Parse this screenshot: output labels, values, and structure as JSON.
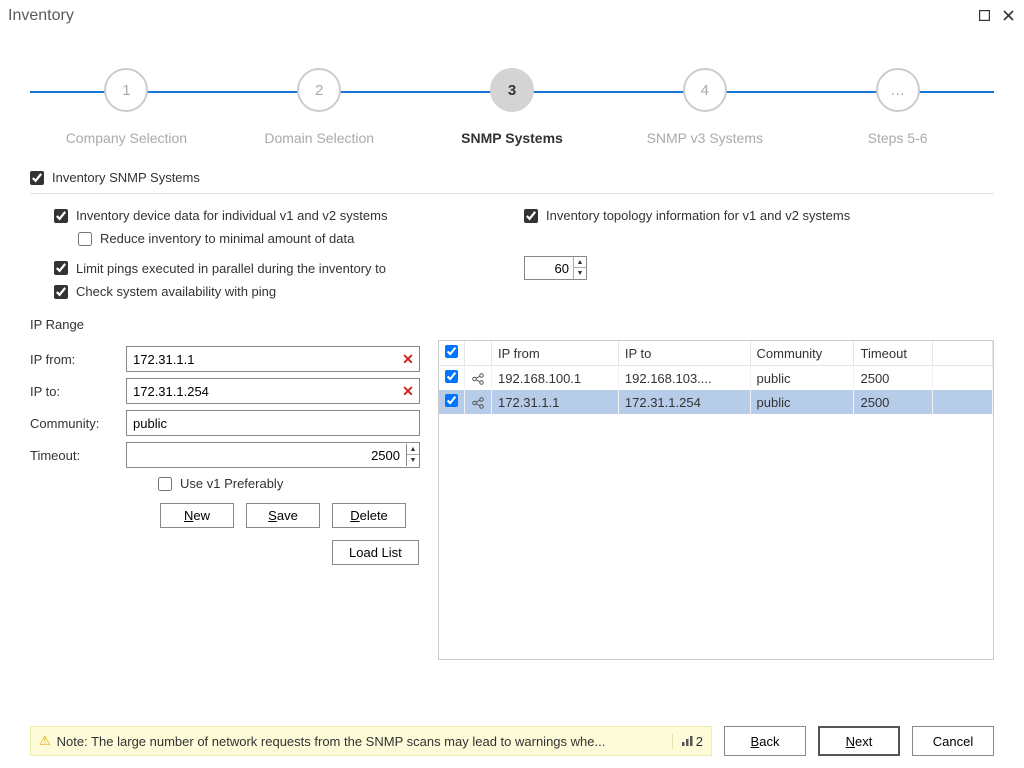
{
  "window": {
    "title": "Inventory"
  },
  "steps": [
    {
      "num": "1",
      "label": "Company Selection"
    },
    {
      "num": "2",
      "label": "Domain Selection"
    },
    {
      "num": "3",
      "label": "SNMP Systems"
    },
    {
      "num": "4",
      "label": "SNMP v3 Systems"
    },
    {
      "num": "…",
      "label": "Steps 5-6"
    }
  ],
  "main_check": "Inventory SNMP Systems",
  "checks": {
    "device_data": "Inventory device data for individual v1 and v2 systems",
    "topology": "Inventory topology information for v1 and v2 systems",
    "reduce": "Reduce inventory to minimal amount of data",
    "limit": "Limit pings executed in parallel during the inventory to",
    "limit_value": "60",
    "availability": "Check system availability with ping"
  },
  "ip_section": "IP Range",
  "form": {
    "ip_from_label": "IP from:",
    "ip_from": "172.31.1.1",
    "ip_to_label": "IP to:",
    "ip_to": "172.31.1.254",
    "community_label": "Community:",
    "community": "public",
    "timeout_label": "Timeout:",
    "timeout": "2500",
    "use_v1": "Use v1 Preferably"
  },
  "buttons": {
    "new": "New",
    "save": "Save",
    "delete": "Delete",
    "loadlist": "Load List",
    "back": "Back",
    "next": "Next",
    "cancel": "Cancel"
  },
  "table": {
    "headers": {
      "ip_from": "IP from",
      "ip_to": "IP to",
      "community": "Community",
      "timeout": "Timeout"
    },
    "rows": [
      {
        "checked": true,
        "ip_from": "192.168.100.1",
        "ip_to": "192.168.103....",
        "community": "public",
        "timeout": "2500",
        "sel": false
      },
      {
        "checked": true,
        "ip_from": "172.31.1.1",
        "ip_to": "172.31.1.254",
        "community": "public",
        "timeout": "2500",
        "sel": true
      }
    ]
  },
  "note": {
    "text": "Note: The large number of network requests from the SNMP scans may lead to warnings whe...",
    "count": "2"
  }
}
